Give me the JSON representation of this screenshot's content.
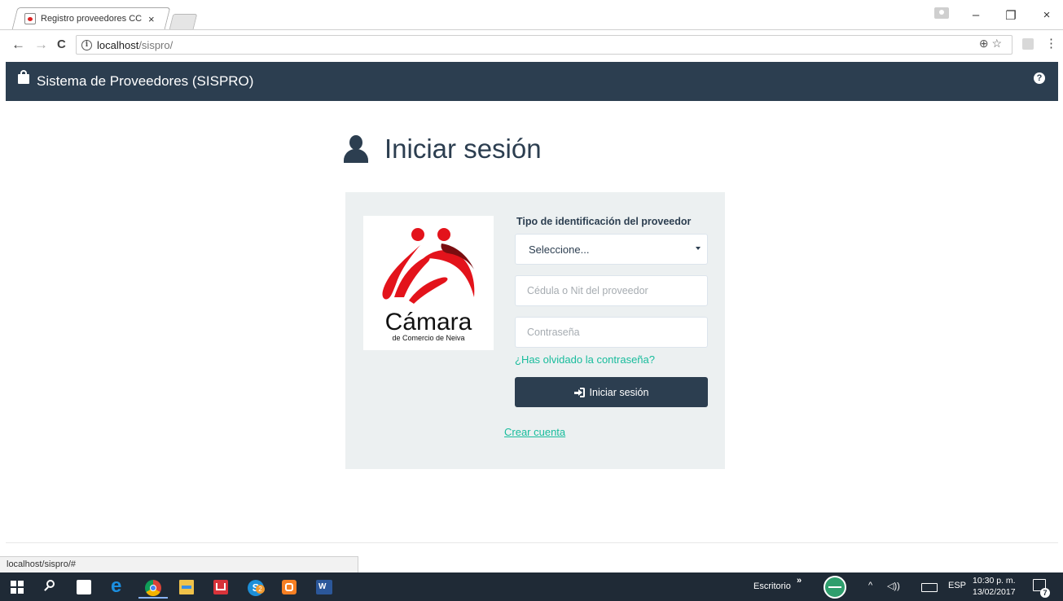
{
  "browser": {
    "tab_title": "Registro proveedores CC",
    "tab_close": "×",
    "window_minimize": "–",
    "window_restore": "❐",
    "window_close": "×",
    "back_icon": "←",
    "forward_icon": "→",
    "reload_icon": "C",
    "info_glyph": "i",
    "url_host": "localhost",
    "url_path": "/sispro/",
    "zoom_star_icons": "⊕ ☆",
    "menu_icon": "⋮",
    "status_url": "localhost/sispro/#"
  },
  "navbar": {
    "brand": "Sistema de Proveedores (SISPRO)",
    "help_glyph": "?"
  },
  "page": {
    "title": "Iniciar sesión"
  },
  "logo": {
    "name": "Cámara",
    "subtitle": "de Comercio de Neiva"
  },
  "form": {
    "id_type_label": "Tipo de identificación del proveedor",
    "id_type_selected": "Seleccione...",
    "id_placeholder": "Cédula o Nit del proveedor",
    "password_placeholder": "Contraseña",
    "forgot_link": "¿Has olvidado la contraseña?",
    "submit_label": "Iniciar sesión",
    "create_account_link": "Crear cuenta"
  },
  "taskbar": {
    "edge_glyph": "e",
    "skype_glyph": "S",
    "skype_badge": "2",
    "word_glyph": "W",
    "desktop_label": "Escritorio",
    "overflow_glyph": "»",
    "tray_chevron": "^",
    "volume_glyph": "◁))",
    "language": "ESP",
    "time": "10:30 p. m.",
    "date": "13/02/2017",
    "notification_count": "7"
  },
  "colors": {
    "navbar_bg": "#2c3e50",
    "card_bg": "#ecf0f1",
    "link": "#18bc9c",
    "button_bg": "#2c3e50",
    "logo_red": "#e3131b"
  }
}
